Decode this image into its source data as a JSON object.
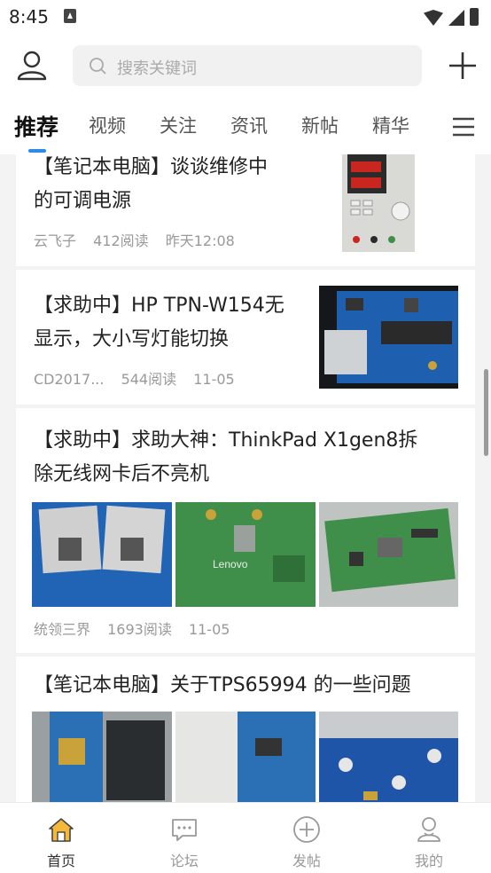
{
  "status_bar": {
    "time": "8:45"
  },
  "header": {
    "search_placeholder": "搜索关键词"
  },
  "tabs": [
    {
      "label": "推荐",
      "active": true
    },
    {
      "label": "视频"
    },
    {
      "label": "关注"
    },
    {
      "label": "资讯"
    },
    {
      "label": "新帖"
    },
    {
      "label": "精华"
    }
  ],
  "feed": [
    {
      "title_line1": "【笔记本电脑】谈谈维修中",
      "title_line2": "的可调电源",
      "author": "云飞子",
      "reads": "412阅读",
      "time": "昨天12:08"
    },
    {
      "title_line1": "【求助中】HP TPN-W154无",
      "title_line2": "显示，大小写灯能切换",
      "author": "CD2017...",
      "reads": "544阅读",
      "time": "11-05"
    },
    {
      "title_line1": "【求助中】求助大神：ThinkPad X1gen8拆",
      "title_line2": "除无线网卡后不亮机",
      "author": "统领三界",
      "reads": "1693阅读",
      "time": "11-05"
    },
    {
      "title_line1": "【笔记本电脑】关于TPS65994 的一些问题"
    }
  ],
  "bottom_nav": [
    {
      "label": "首页",
      "icon": "home-icon",
      "active": true
    },
    {
      "label": "论坛",
      "icon": "forum-icon"
    },
    {
      "label": "发帖",
      "icon": "post-icon"
    },
    {
      "label": "我的",
      "icon": "profile-icon"
    }
  ],
  "colors": {
    "accent": "#2a8ce8",
    "home_icon": "#f5b93a",
    "pcb_blue": "#1f5fb0",
    "pcb_green": "#3f8f4a"
  }
}
